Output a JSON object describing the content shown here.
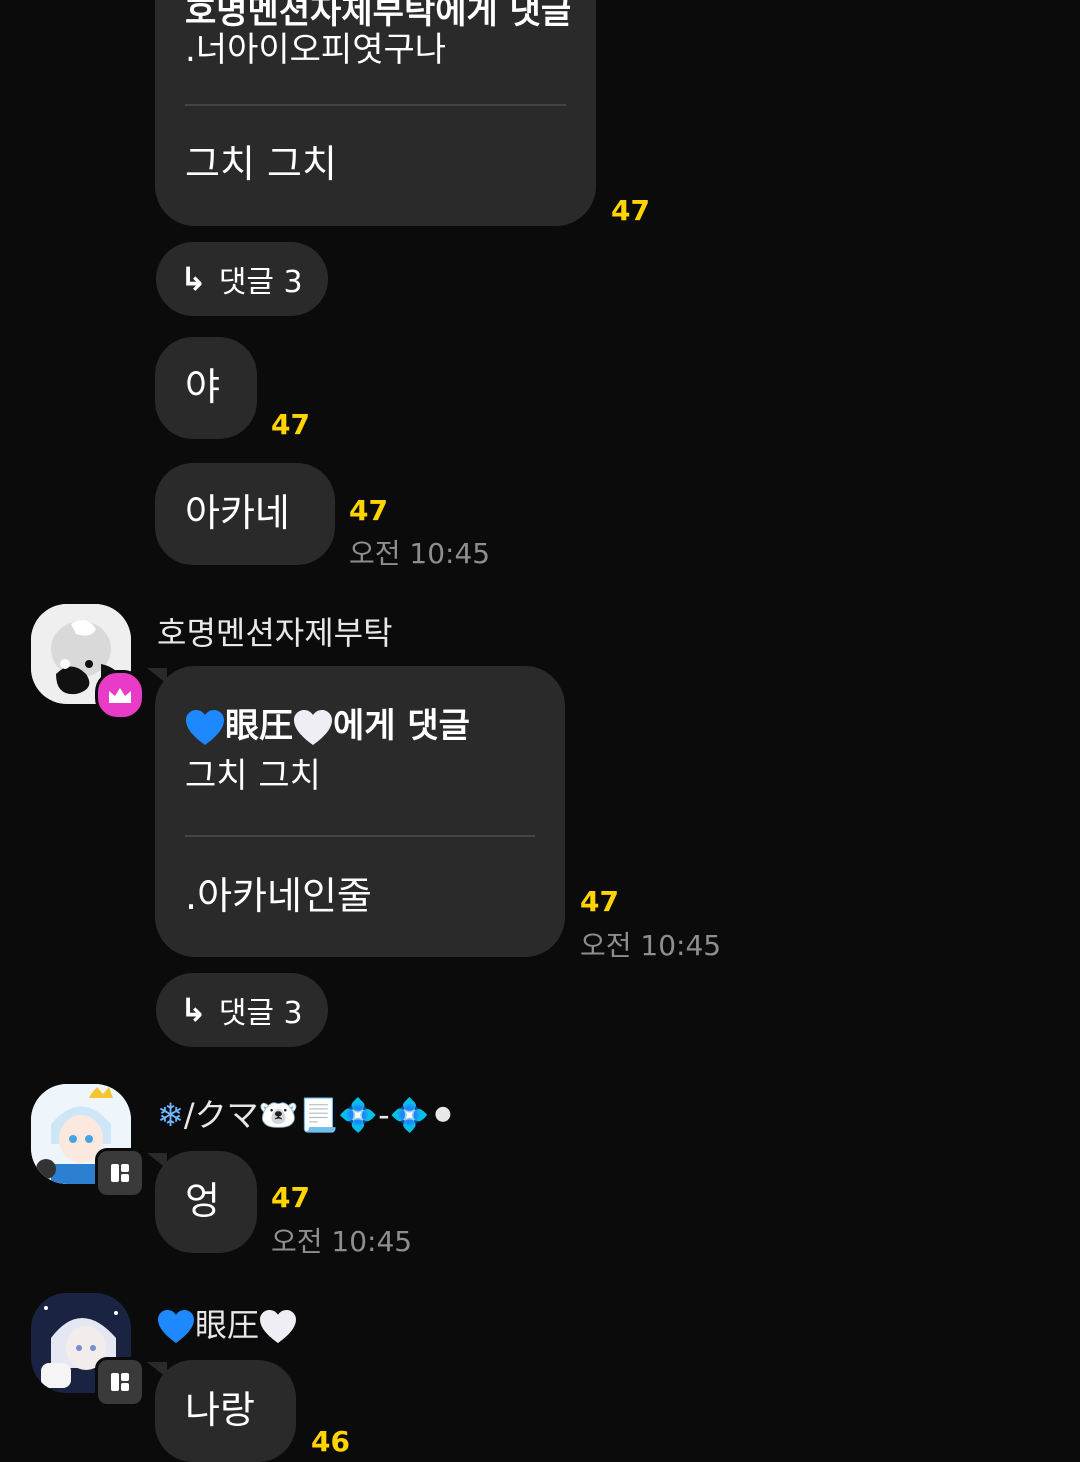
{
  "messages": {
    "m1": {
      "quote_line1": "호명멘션자제부탁에게 댓글",
      "quote_line2": ".너아이오피엿구나",
      "reply": "그치 그치",
      "unread": "47"
    },
    "reply_pill_1": {
      "arrow": "↳",
      "label": "댓글 3"
    },
    "m2": {
      "text": "야",
      "unread": "47"
    },
    "m3": {
      "text": "아카네",
      "unread": "47",
      "time": "오전 10:45"
    },
    "m4": {
      "sender": "호명멘션자제부탁",
      "quote_name_mid": "眼圧",
      "quote_suffix": "에게 댓글",
      "quote_line2": "그치 그치",
      "reply": ".아카네인줄",
      "unread": "47",
      "time": "오전 10:45"
    },
    "reply_pill_2": {
      "arrow": "↳",
      "label": "댓글 3"
    },
    "m5": {
      "sender_prefix": "❄",
      "sender_text": "/クマ",
      "sender_suffix": "🐻‍❄️📃💠-💠⚫",
      "text": "엉",
      "unread": "47",
      "time": "오전 10:45"
    },
    "m6": {
      "sender_mid": "眼圧",
      "text": "나랑",
      "unread": "46"
    }
  },
  "colors": {
    "background": "#0b0b0b",
    "bubble": "#2a2a2a",
    "unread": "#ffd400",
    "time": "#8e8e8e",
    "host_badge": "#e83cc8",
    "staff_badge": "#3a3a3a"
  }
}
